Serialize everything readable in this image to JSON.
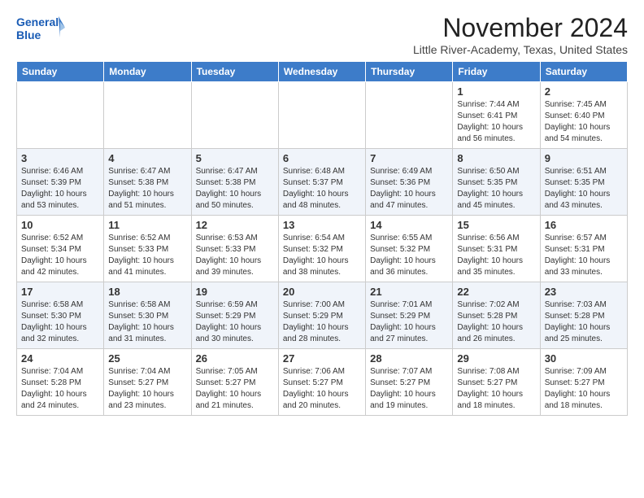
{
  "header": {
    "logo_line1": "General",
    "logo_line2": "Blue",
    "month": "November 2024",
    "location": "Little River-Academy, Texas, United States"
  },
  "weekdays": [
    "Sunday",
    "Monday",
    "Tuesday",
    "Wednesday",
    "Thursday",
    "Friday",
    "Saturday"
  ],
  "weeks": [
    [
      {
        "day": "",
        "info": ""
      },
      {
        "day": "",
        "info": ""
      },
      {
        "day": "",
        "info": ""
      },
      {
        "day": "",
        "info": ""
      },
      {
        "day": "",
        "info": ""
      },
      {
        "day": "1",
        "info": "Sunrise: 7:44 AM\nSunset: 6:41 PM\nDaylight: 10 hours and 56 minutes."
      },
      {
        "day": "2",
        "info": "Sunrise: 7:45 AM\nSunset: 6:40 PM\nDaylight: 10 hours and 54 minutes."
      }
    ],
    [
      {
        "day": "3",
        "info": "Sunrise: 6:46 AM\nSunset: 5:39 PM\nDaylight: 10 hours and 53 minutes."
      },
      {
        "day": "4",
        "info": "Sunrise: 6:47 AM\nSunset: 5:38 PM\nDaylight: 10 hours and 51 minutes."
      },
      {
        "day": "5",
        "info": "Sunrise: 6:47 AM\nSunset: 5:38 PM\nDaylight: 10 hours and 50 minutes."
      },
      {
        "day": "6",
        "info": "Sunrise: 6:48 AM\nSunset: 5:37 PM\nDaylight: 10 hours and 48 minutes."
      },
      {
        "day": "7",
        "info": "Sunrise: 6:49 AM\nSunset: 5:36 PM\nDaylight: 10 hours and 47 minutes."
      },
      {
        "day": "8",
        "info": "Sunrise: 6:50 AM\nSunset: 5:35 PM\nDaylight: 10 hours and 45 minutes."
      },
      {
        "day": "9",
        "info": "Sunrise: 6:51 AM\nSunset: 5:35 PM\nDaylight: 10 hours and 43 minutes."
      }
    ],
    [
      {
        "day": "10",
        "info": "Sunrise: 6:52 AM\nSunset: 5:34 PM\nDaylight: 10 hours and 42 minutes."
      },
      {
        "day": "11",
        "info": "Sunrise: 6:52 AM\nSunset: 5:33 PM\nDaylight: 10 hours and 41 minutes."
      },
      {
        "day": "12",
        "info": "Sunrise: 6:53 AM\nSunset: 5:33 PM\nDaylight: 10 hours and 39 minutes."
      },
      {
        "day": "13",
        "info": "Sunrise: 6:54 AM\nSunset: 5:32 PM\nDaylight: 10 hours and 38 minutes."
      },
      {
        "day": "14",
        "info": "Sunrise: 6:55 AM\nSunset: 5:32 PM\nDaylight: 10 hours and 36 minutes."
      },
      {
        "day": "15",
        "info": "Sunrise: 6:56 AM\nSunset: 5:31 PM\nDaylight: 10 hours and 35 minutes."
      },
      {
        "day": "16",
        "info": "Sunrise: 6:57 AM\nSunset: 5:31 PM\nDaylight: 10 hours and 33 minutes."
      }
    ],
    [
      {
        "day": "17",
        "info": "Sunrise: 6:58 AM\nSunset: 5:30 PM\nDaylight: 10 hours and 32 minutes."
      },
      {
        "day": "18",
        "info": "Sunrise: 6:58 AM\nSunset: 5:30 PM\nDaylight: 10 hours and 31 minutes."
      },
      {
        "day": "19",
        "info": "Sunrise: 6:59 AM\nSunset: 5:29 PM\nDaylight: 10 hours and 30 minutes."
      },
      {
        "day": "20",
        "info": "Sunrise: 7:00 AM\nSunset: 5:29 PM\nDaylight: 10 hours and 28 minutes."
      },
      {
        "day": "21",
        "info": "Sunrise: 7:01 AM\nSunset: 5:29 PM\nDaylight: 10 hours and 27 minutes."
      },
      {
        "day": "22",
        "info": "Sunrise: 7:02 AM\nSunset: 5:28 PM\nDaylight: 10 hours and 26 minutes."
      },
      {
        "day": "23",
        "info": "Sunrise: 7:03 AM\nSunset: 5:28 PM\nDaylight: 10 hours and 25 minutes."
      }
    ],
    [
      {
        "day": "24",
        "info": "Sunrise: 7:04 AM\nSunset: 5:28 PM\nDaylight: 10 hours and 24 minutes."
      },
      {
        "day": "25",
        "info": "Sunrise: 7:04 AM\nSunset: 5:27 PM\nDaylight: 10 hours and 23 minutes."
      },
      {
        "day": "26",
        "info": "Sunrise: 7:05 AM\nSunset: 5:27 PM\nDaylight: 10 hours and 21 minutes."
      },
      {
        "day": "27",
        "info": "Sunrise: 7:06 AM\nSunset: 5:27 PM\nDaylight: 10 hours and 20 minutes."
      },
      {
        "day": "28",
        "info": "Sunrise: 7:07 AM\nSunset: 5:27 PM\nDaylight: 10 hours and 19 minutes."
      },
      {
        "day": "29",
        "info": "Sunrise: 7:08 AM\nSunset: 5:27 PM\nDaylight: 10 hours and 18 minutes."
      },
      {
        "day": "30",
        "info": "Sunrise: 7:09 AM\nSunset: 5:27 PM\nDaylight: 10 hours and 18 minutes."
      }
    ]
  ]
}
